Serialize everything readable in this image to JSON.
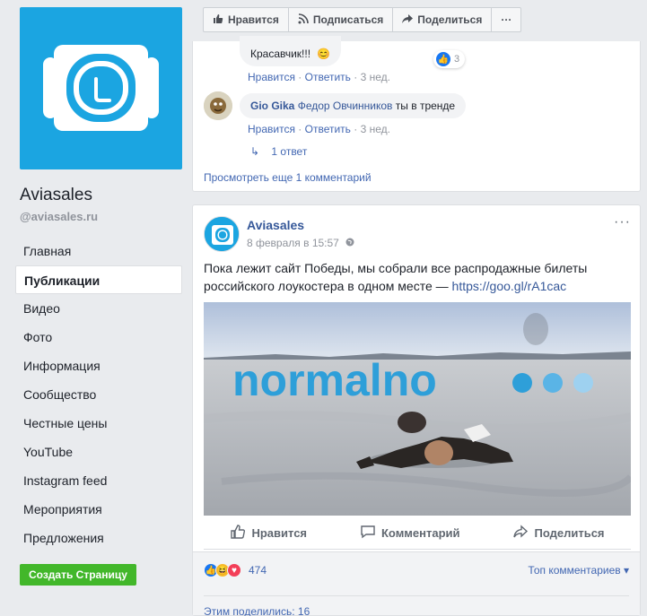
{
  "page": {
    "name": "Aviasales",
    "handle": "@aviasales.ru",
    "brand_color": "#1ba5e1"
  },
  "nav": {
    "items": [
      {
        "label": "Главная"
      },
      {
        "label": "Публикации",
        "active": true
      },
      {
        "label": "Видео"
      },
      {
        "label": "Фото"
      },
      {
        "label": "Информация"
      },
      {
        "label": "Сообщество"
      },
      {
        "label": "Честные цены"
      },
      {
        "label": "YouTube"
      },
      {
        "label": "Instagram feed"
      },
      {
        "label": "Мероприятия"
      },
      {
        "label": "Предложения"
      }
    ],
    "create_page": "Создать Страницу"
  },
  "topbar": {
    "like": "Нравится",
    "subscribe": "Подписаться",
    "share": "Поделиться",
    "more": "···"
  },
  "comments": {
    "comment1": {
      "text": "Красавчик!!!",
      "like": "Нравится",
      "reply": "Ответить",
      "time": "3 нед.",
      "reactions": "3"
    },
    "comment2": {
      "author": "Gio Gika",
      "mention": "Федор Овчинников",
      "text": "ты в тренде",
      "like": "Нравится",
      "reply": "Ответить",
      "time": "3 нед.",
      "replies": "1 ответ"
    },
    "view_more": "Просмотреть еще 1 комментарий"
  },
  "post": {
    "author": "Aviasales",
    "time": "8 февраля в 15:57",
    "text": "Пока лежит сайт Победы, мы собрали все распродажные билеты российского лоукостера в одном месте — ",
    "link": "https://goo.gl/rA1cac",
    "image_text": "normalno",
    "actions": {
      "like": "Нравится",
      "comment": "Комментарий",
      "share": "Поделиться"
    },
    "reactions_count": "474",
    "top_comments": "Топ комментариев ▾",
    "shares": "Этим поделились: 16"
  }
}
